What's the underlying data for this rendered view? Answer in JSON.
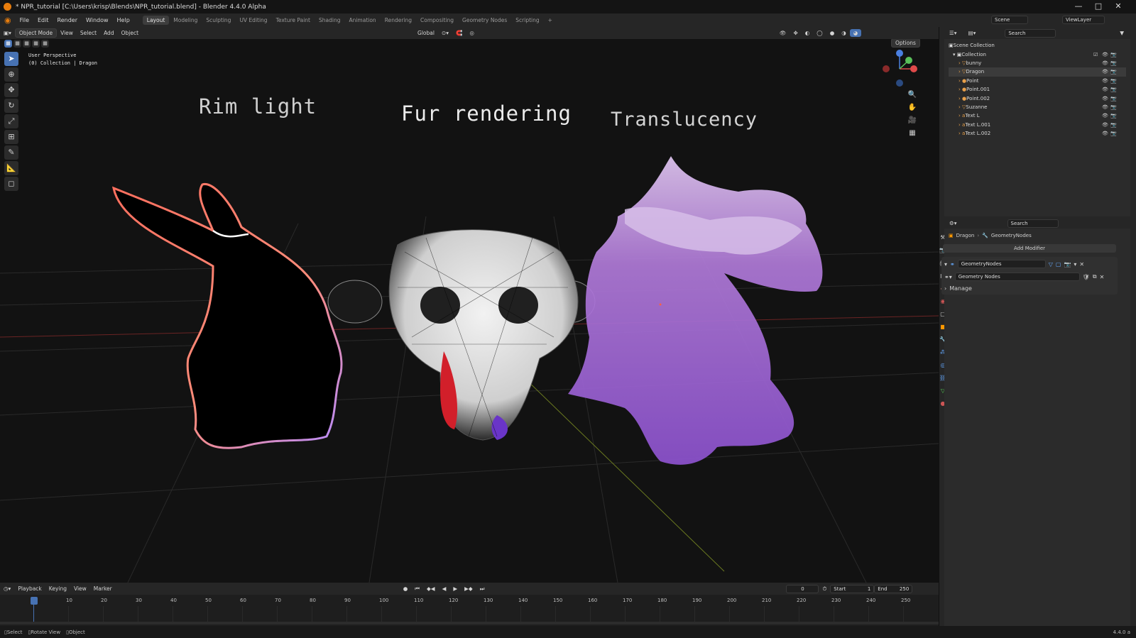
{
  "window": {
    "title": "* NPR_tutorial [C:\\Users\\krisp\\Blends\\NPR_tutorial.blend] - Blender 4.4.0 Alpha",
    "minimize": "—",
    "maximize": "□",
    "close": "✕"
  },
  "menu": {
    "file": "File",
    "edit": "Edit",
    "render": "Render",
    "window": "Window",
    "help": "Help"
  },
  "workspaces": [
    "Layout",
    "Modeling",
    "Sculpting",
    "UV Editing",
    "Texture Paint",
    "Shading",
    "Animation",
    "Rendering",
    "Compositing",
    "Geometry Nodes",
    "Scripting"
  ],
  "top_right": {
    "scene": "Scene",
    "view_layer": "ViewLayer"
  },
  "viewport_header": {
    "mode": "Object Mode",
    "view": "View",
    "select": "Select",
    "add": "Add",
    "object": "Object",
    "orientation": "Global",
    "options": "Options"
  },
  "viewport": {
    "perspective": "User Perspective",
    "collection_info": "(0) Collection | Dragon",
    "text_rim": "Rim light",
    "text_fur": "Fur rendering",
    "text_translucency": "Translucency"
  },
  "outliner": {
    "search_placeholder": "Search",
    "scene_collection": "Scene Collection",
    "collection": "Collection",
    "items": [
      "bunny",
      "Dragon",
      "Point",
      "Point.001",
      "Point.002",
      "Suzanne",
      "Text L",
      "Text L.001",
      "Text L.002"
    ]
  },
  "properties": {
    "search_placeholder": "Search",
    "breadcrumb_object": "Dragon",
    "breadcrumb_modifier": "GeometryNodes",
    "add_modifier": "Add Modifier",
    "modifier_name": "GeometryNodes",
    "node_group": "Geometry Nodes",
    "manage": "Manage"
  },
  "timeline": {
    "playback": "Playback",
    "keying": "Keying",
    "view": "View",
    "marker": "Marker",
    "current_frame": "0",
    "start_label": "Start",
    "start": "1",
    "end_label": "End",
    "end": "250",
    "ticks": [
      "0",
      "10",
      "20",
      "30",
      "40",
      "50",
      "60",
      "70",
      "80",
      "90",
      "100",
      "110",
      "120",
      "130",
      "140",
      "150",
      "160",
      "170",
      "180",
      "190",
      "200",
      "210",
      "220",
      "230",
      "240",
      "250"
    ]
  },
  "status": {
    "select": "Select",
    "rotate_view": "Rotate View",
    "object": "Object",
    "version": "4.4.0 a"
  },
  "colors": {
    "accent": "#4772b3",
    "rim_red": "#ff6f5e",
    "rim_purple": "#b58cff",
    "translucent": "#a86be0"
  }
}
